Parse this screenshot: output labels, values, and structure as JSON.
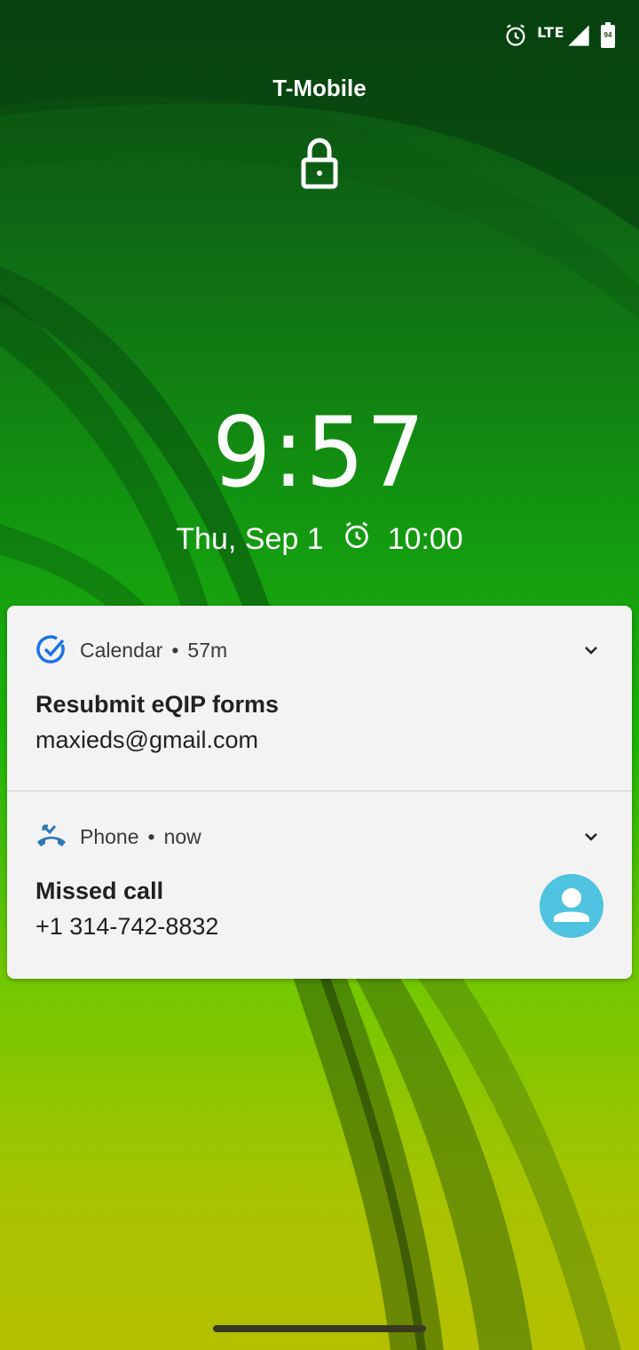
{
  "status_bar": {
    "network": "LTE",
    "battery_level": "94",
    "icons": [
      "alarm-icon",
      "lte-icon",
      "signal-icon",
      "battery-icon"
    ]
  },
  "lock_screen": {
    "carrier": "T-Mobile",
    "time": "9:57",
    "date": "Thu, Sep 1",
    "alarm_time": "10:00"
  },
  "notifications": [
    {
      "app": "Calendar",
      "age": "57m",
      "title": "Resubmit eQIP forms",
      "body": "maxieds@gmail.com",
      "icon": "calendar-check-icon",
      "accent": "#1a73e8"
    },
    {
      "app": "Phone",
      "age": "now",
      "title": "Missed call",
      "body": "+1 314-742-8832",
      "icon": "missed-call-icon",
      "accent": "#2b78b8",
      "avatar_color": "#4fc3e0"
    }
  ],
  "separator": "•"
}
